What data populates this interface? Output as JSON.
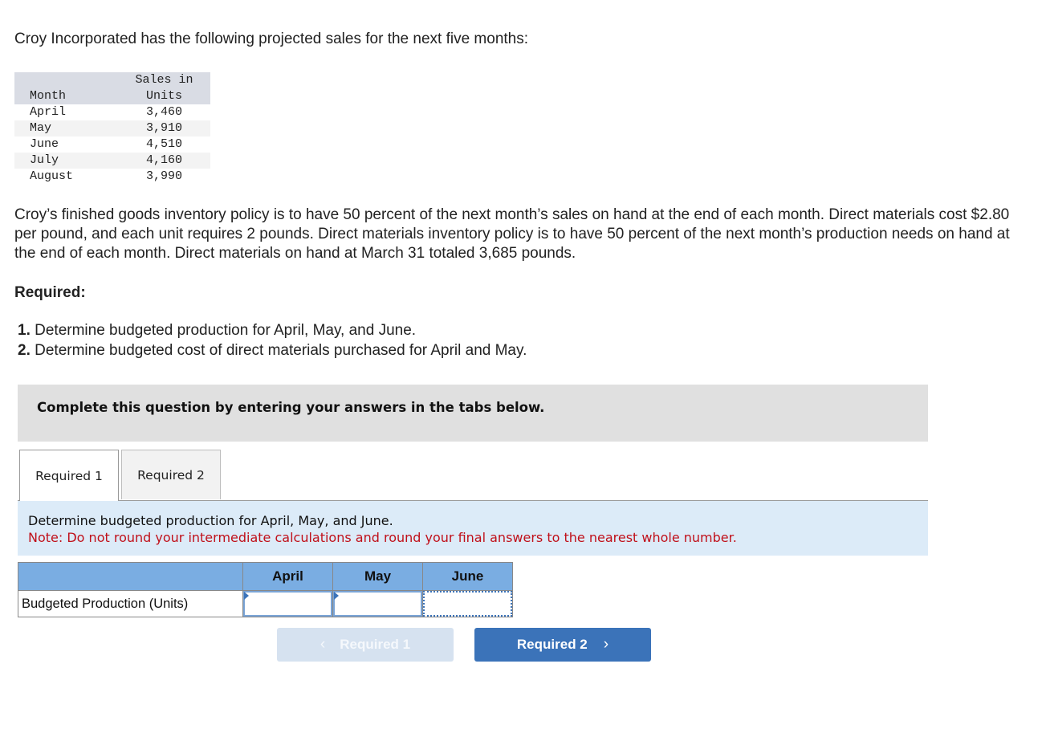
{
  "problem": {
    "intro": "Croy Incorporated has the following projected sales for the next five months:",
    "sales_table": {
      "headers": {
        "month": "Month",
        "units_line1": "Sales in",
        "units_line2": "Units"
      },
      "rows": [
        {
          "month": "April",
          "units": "3,460"
        },
        {
          "month": "May",
          "units": "3,910"
        },
        {
          "month": "June",
          "units": "4,510"
        },
        {
          "month": "July",
          "units": "4,160"
        },
        {
          "month": "August",
          "units": "3,990"
        }
      ]
    },
    "policy": "Croy’s finished goods inventory policy is to have 50 percent of the next month’s sales on hand at the end of each month. Direct materials cost $2.80 per pound, and each unit requires 2 pounds. Direct materials inventory policy is to have 50 percent of the next month’s production needs on hand at the end of each month. Direct materials on hand at March 31 totaled 3,685 pounds.",
    "required_heading": "Required:",
    "requirements": [
      {
        "num": "1.",
        "text": " Determine budgeted production for April, May, and June."
      },
      {
        "num": "2.",
        "text": " Determine budgeted cost of direct materials purchased for April and May."
      }
    ]
  },
  "instruction": "Complete this question by entering your answers in the tabs below.",
  "tabs": [
    {
      "label": "Required 1",
      "active": true
    },
    {
      "label": "Required 2",
      "active": false
    }
  ],
  "prompt": {
    "main": "Determine budgeted production for April, May, and June.",
    "note": "Note: Do not round your intermediate calculations and round your final answers to the nearest whole number."
  },
  "answer_table": {
    "headers": [
      "",
      "April",
      "May",
      "June"
    ],
    "row_label": "Budgeted Production (Units)",
    "values": {
      "april": "",
      "may": "",
      "june": ""
    }
  },
  "nav": {
    "prev_label": "Required 1",
    "next_label": "Required 2",
    "prev_icon": "‹",
    "next_icon": "›"
  }
}
